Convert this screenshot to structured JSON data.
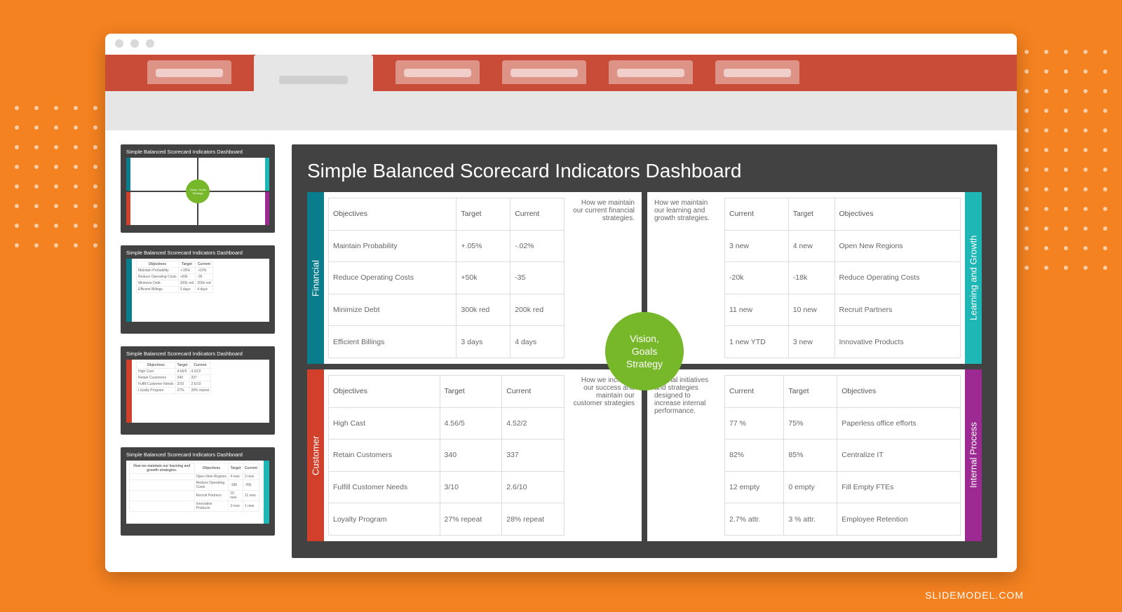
{
  "watermark": "SLIDEMODEL.COM",
  "slide_title": "Simple Balanced Scorecard Indicators Dashboard",
  "center": {
    "line1": "Vision,",
    "line2": "Goals",
    "line3": "Strategy"
  },
  "quadrants": {
    "financial": {
      "label": "Financial",
      "desc": "How we maintain our current financial strategies.",
      "headers": [
        "Objectives",
        "Target",
        "Current"
      ],
      "rows": [
        [
          "Maintain Probability",
          "+.05%",
          "-.02%"
        ],
        [
          "Reduce Operating Costs",
          "+50k",
          "-35"
        ],
        [
          "Minimize Debt",
          "300k red",
          "200k red"
        ],
        [
          "Efficient Billings",
          "3 days",
          "4 days"
        ]
      ]
    },
    "learning": {
      "label": "Learning and Growth",
      "desc": "How we maintain our learning and growth strategies.",
      "headers": [
        "Current",
        "Target",
        "Objectives"
      ],
      "rows": [
        [
          "3 new",
          "4 new",
          "Open New Regions"
        ],
        [
          "-20k",
          "-18k",
          "Reduce Operating Costs"
        ],
        [
          "11 new",
          "10 new",
          "Recruit Partners"
        ],
        [
          "1 new YTD",
          "3 new",
          "Innovative Products"
        ]
      ]
    },
    "customer": {
      "label": "Customer",
      "desc": "How we increase our success and maintain our customer strategies",
      "headers": [
        "Objectives",
        "Target",
        "Current"
      ],
      "rows": [
        [
          "High Cast",
          "4.56/5",
          "4.52/2"
        ],
        [
          "Retain Customers",
          "340",
          "337"
        ],
        [
          "Fulfill Customer Needs",
          "3/10",
          "2.6/10"
        ],
        [
          "Loyalty Program",
          "27% repeat",
          "28% repeat"
        ]
      ]
    },
    "internal": {
      "label": "Internal Process",
      "desc": "Internal initiatives and strategies designed to increase internal performance.",
      "headers": [
        "Current",
        "Target",
        "Objectives"
      ],
      "rows": [
        [
          "77 %",
          "75%",
          "Paperless office efforts"
        ],
        [
          "82%",
          "85%",
          "Centralize IT"
        ],
        [
          "12 empty",
          "0 empty",
          "Fill Empty FTEs"
        ],
        [
          "2.7% attr.",
          "3 % attr.",
          "Employee Retention"
        ]
      ]
    }
  },
  "thumbs": [
    {
      "title": "Simple Balanced Scorecard Indicators Dashboard",
      "variant": "full"
    },
    {
      "title": "Simple Balanced Scorecard Indicators Dashboard",
      "variant": "financial"
    },
    {
      "title": "Simple Balanced Scorecard Indicators Dashboard",
      "variant": "customer"
    },
    {
      "title": "Simple Balanced Scorecard Indicators Dashboard",
      "variant": "learning"
    }
  ]
}
